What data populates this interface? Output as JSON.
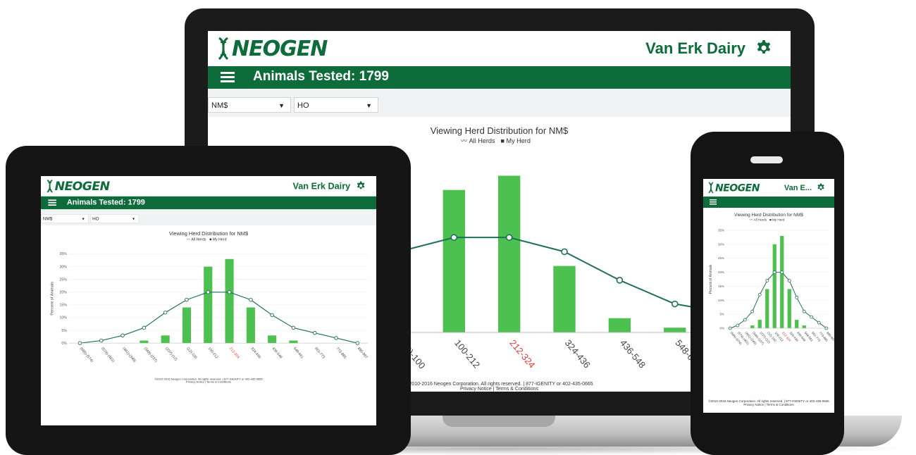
{
  "app": {
    "logo_text": "NEOGEN",
    "herd_name": "Van Erk Dairy",
    "herd_name_short": "Van E...",
    "animals_tested": "Animals Tested: 1799",
    "filters": {
      "trait": "NM$",
      "breed": "HO"
    },
    "footer_line1": "©2010-2016 Neogen Corporation. All rights reserved. | 877-IGENITY or 402-435-0665",
    "footer_line2": "Privacy Notice | Terms & Conditions"
  },
  "colors": {
    "brand_green": "#0e6b3a",
    "bar_green": "#4dc14f",
    "highlight_red": "#e53935",
    "curve": "#1f6f5a"
  },
  "chart_data": {
    "type": "bar",
    "title": "Viewing Herd Distribution for NM$",
    "ylabel": "Percent of Animals",
    "legend": [
      "All Herds",
      "My Herd"
    ],
    "legend_position": "top-center",
    "highlight_category": "212-324",
    "categories": [
      "(685)-(574)",
      "(574)-(461)",
      "(461)-(349)",
      "(349)-(237)",
      "(237)-(12)",
      "(12)-100",
      "100-212",
      "212-324",
      "324-436",
      "436-548",
      "548-661",
      "661-773",
      "773-885",
      "885-997"
    ],
    "ylim": [
      0,
      35
    ],
    "y_ticks": [
      "0%",
      "5%",
      "10%",
      "15%",
      "20%",
      "25%",
      "30%",
      "35%"
    ],
    "series": [
      {
        "name": "My Herd",
        "type": "bar",
        "values": [
          0,
          0,
          0,
          1,
          3,
          14,
          30,
          33,
          14,
          3,
          1,
          0,
          0,
          0
        ]
      },
      {
        "name": "All Herds",
        "type": "line",
        "values": [
          0,
          1,
          3,
          6,
          12,
          17,
          20,
          20,
          17,
          11,
          6,
          4,
          2,
          0
        ]
      }
    ]
  }
}
